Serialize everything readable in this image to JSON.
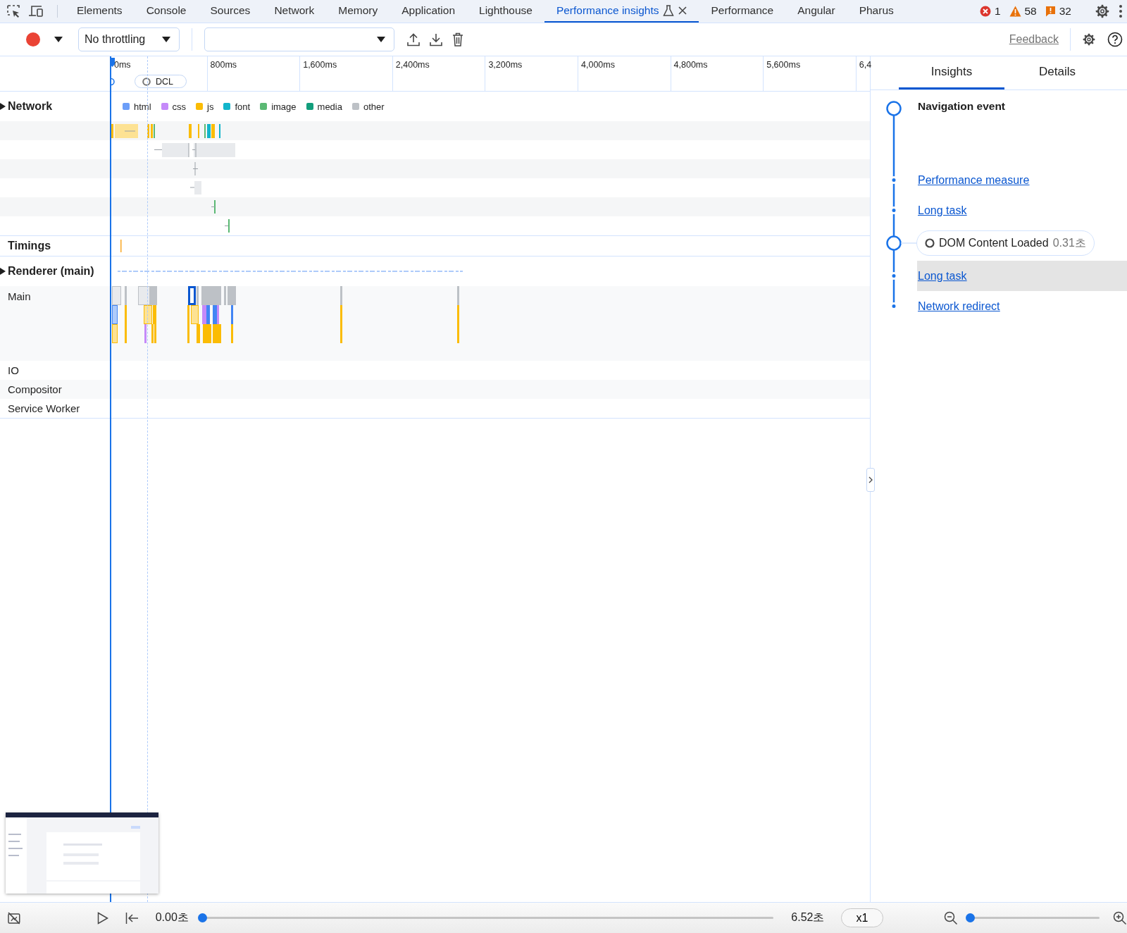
{
  "devtools_tabs": [
    {
      "label": "Elements",
      "selected": false
    },
    {
      "label": "Console",
      "selected": false
    },
    {
      "label": "Sources",
      "selected": false
    },
    {
      "label": "Network",
      "selected": false
    },
    {
      "label": "Memory",
      "selected": false
    },
    {
      "label": "Application",
      "selected": false
    },
    {
      "label": "Lighthouse",
      "selected": false
    },
    {
      "label": "Performance insights",
      "selected": true,
      "experimental": true,
      "closable": true
    },
    {
      "label": "Performance",
      "selected": false
    },
    {
      "label": "Angular",
      "selected": false
    },
    {
      "label": "Pharus",
      "selected": false
    }
  ],
  "status_counts": {
    "errors": "1",
    "warnings": "58",
    "issues": "32"
  },
  "toolbar": {
    "throttling": "No throttling",
    "feedback": "Feedback"
  },
  "ruler": {
    "ticks": [
      "0ms",
      "800ms",
      "1,600ms",
      "2,400ms",
      "3,200ms",
      "4,000ms",
      "4,800ms",
      "5,600ms",
      "6,4"
    ],
    "marker": "DCL"
  },
  "legend": [
    {
      "label": "html",
      "color": "#6c9ef8"
    },
    {
      "label": "css",
      "color": "#c58af9"
    },
    {
      "label": "js",
      "color": "#fbbc04"
    },
    {
      "label": "font",
      "color": "#12b5cb"
    },
    {
      "label": "image",
      "color": "#5bb974"
    },
    {
      "label": "media",
      "color": "#129e7c"
    },
    {
      "label": "other",
      "color": "#bdc1c6"
    }
  ],
  "tracks": [
    {
      "kind": "network",
      "label": "Network"
    },
    {
      "kind": "timings",
      "label": "Timings"
    },
    {
      "kind": "renderer",
      "label": "Renderer (main)"
    },
    {
      "kind": "main",
      "label": "Main"
    },
    {
      "kind": "plain",
      "label": "IO"
    },
    {
      "kind": "plain",
      "label": "Compositor"
    },
    {
      "kind": "plain",
      "label": "Service Worker"
    }
  ],
  "insights": {
    "tabs": [
      {
        "label": "Insights",
        "selected": true
      },
      {
        "label": "Details",
        "selected": false
      }
    ],
    "items": [
      {
        "kind": "event",
        "label": "Navigation event",
        "selected": false
      },
      {
        "kind": "link",
        "label": "Performance measure",
        "selected": false
      },
      {
        "kind": "link",
        "label": "Long task",
        "selected": false
      },
      {
        "kind": "marker",
        "label": "DOM Content Loaded",
        "time": "0.31초",
        "selected": false
      },
      {
        "kind": "link",
        "label": "Long task",
        "selected": true
      },
      {
        "kind": "link",
        "label": "Network redirect",
        "selected": false
      }
    ]
  },
  "playback": {
    "current": "0.00초",
    "duration": "6.52초",
    "scrubber": {
      "level": 0
    },
    "speed": "x1",
    "zoom": {
      "level": 0.02
    }
  }
}
